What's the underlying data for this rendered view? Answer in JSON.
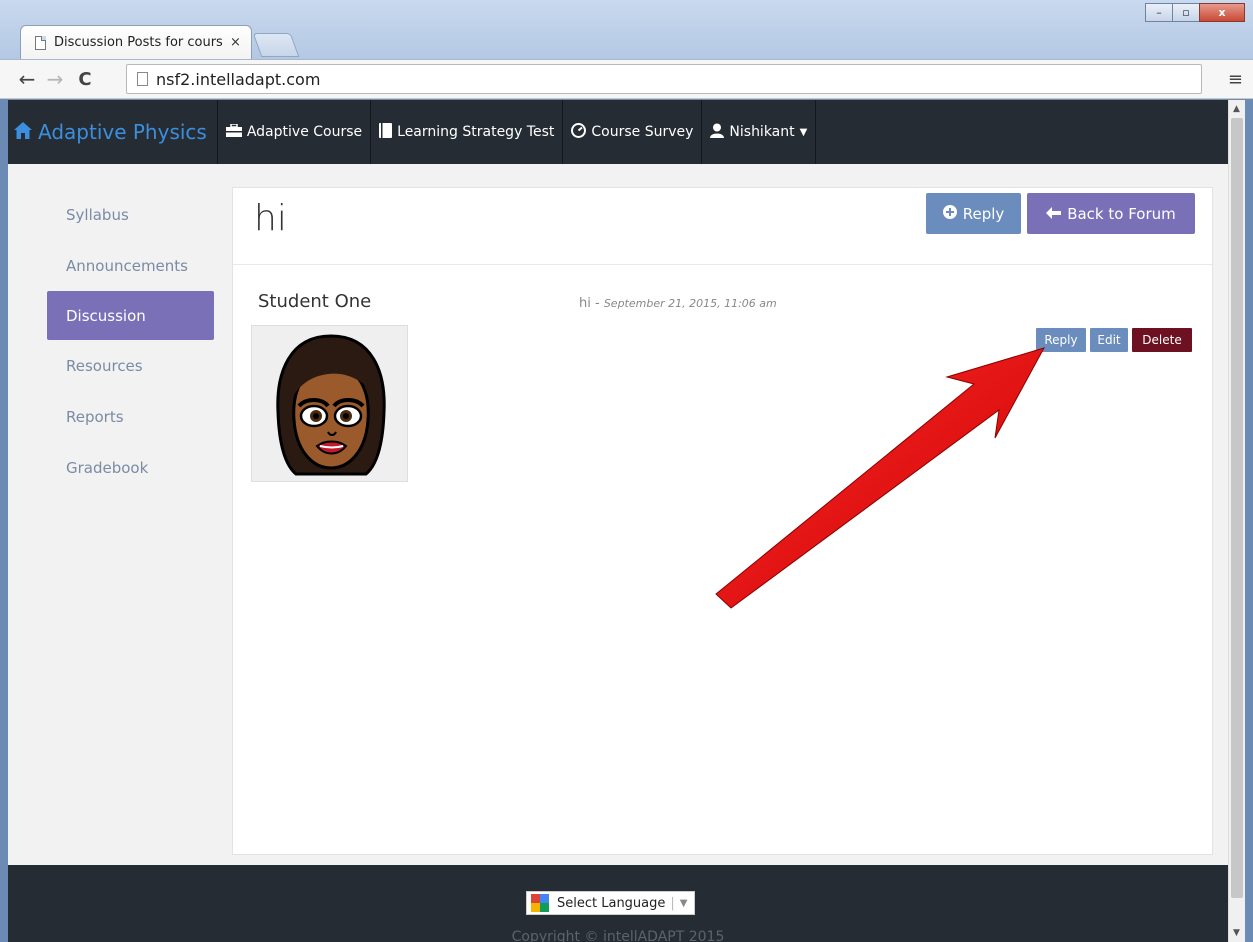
{
  "browser": {
    "tab_title": "Discussion Posts for cours",
    "tab_close": "×",
    "url": "nsf2.intelladapt.com",
    "back": "←",
    "forward": "→",
    "reload": "C",
    "menu": "≡",
    "win_min": "–",
    "win_max": "▫",
    "win_close": "x"
  },
  "navbar": {
    "brand": "Adaptive Physics",
    "items": [
      {
        "label": "Adaptive Course",
        "icon": "briefcase-icon"
      },
      {
        "label": "Learning Strategy Test",
        "icon": "book-icon"
      },
      {
        "label": "Course Survey",
        "icon": "dashboard-icon"
      },
      {
        "label": "Nishikant",
        "icon": "user-icon"
      }
    ]
  },
  "sidebar": {
    "items": [
      {
        "label": "Syllabus",
        "active": false
      },
      {
        "label": "Announcements",
        "active": false
      },
      {
        "label": "Discussion",
        "active": true
      },
      {
        "label": "Resources",
        "active": false
      },
      {
        "label": "Reports",
        "active": false
      },
      {
        "label": "Gradebook",
        "active": false
      }
    ]
  },
  "post": {
    "title": "hi",
    "reply_button": "Reply",
    "back_button": "Back to Forum",
    "author": "Student One",
    "subject": "hi",
    "date": "September 21, 2015, 11:06 am",
    "actions": {
      "reply": "Reply",
      "edit": "Edit",
      "delete": "Delete"
    }
  },
  "footer": {
    "language": "Select Language",
    "copyright": "Copyright © intellADAPT 2015"
  },
  "colors": {
    "navbar": "#262c33",
    "brand": "#3b8fde",
    "primary": "#6b8dbd",
    "accent": "#7a70b8",
    "danger": "#6d1022",
    "annotation": "#e81818"
  }
}
